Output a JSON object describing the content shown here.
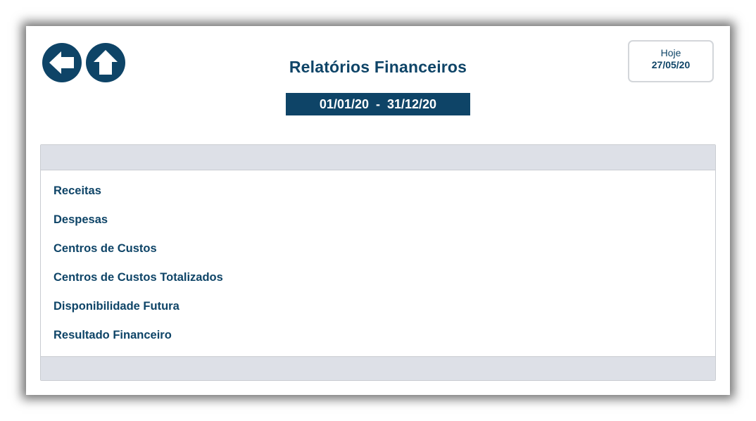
{
  "header": {
    "title": "Relatórios Financeiros",
    "date_range": "01/01/20  -  31/12/20",
    "today_label": "Hoje",
    "today_date": "27/05/20"
  },
  "nav": {
    "back_icon": "arrow-left-icon",
    "home_icon": "arrow-up-icon"
  },
  "reports": [
    {
      "label": "Receitas"
    },
    {
      "label": "Despesas"
    },
    {
      "label": "Centros de Custos"
    },
    {
      "label": "Centros de Custos Totalizados"
    },
    {
      "label": "Disponibilidade Futura"
    },
    {
      "label": "Resultado Financeiro"
    }
  ],
  "colors": {
    "primary": "#0e4467",
    "panel_band": "#dde0e7",
    "border": "#c9ccd1"
  }
}
